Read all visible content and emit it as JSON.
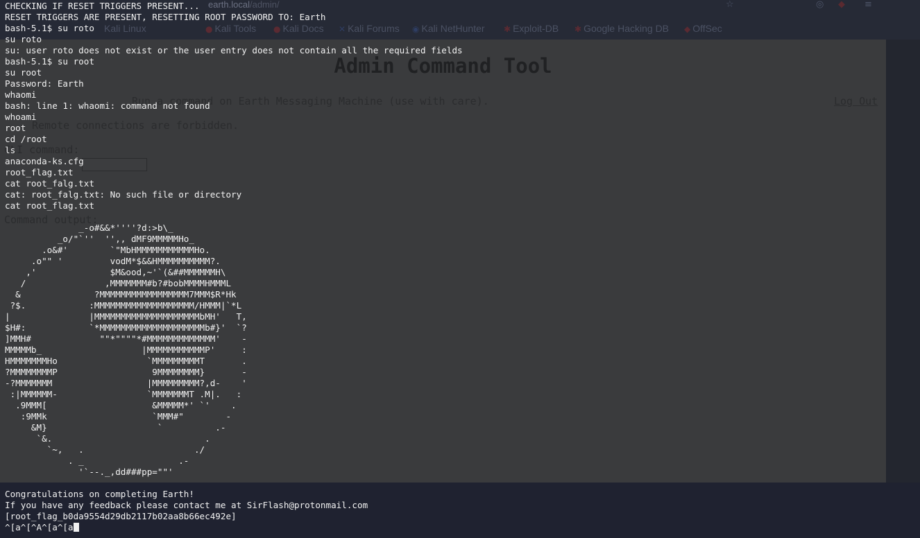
{
  "browser": {
    "url_host": "earth.local",
    "url_path": "/admin/",
    "bookmarks": [
      "Kali Linux",
      "Kali Tools",
      "Kali Docs",
      "Kali Forums",
      "Kali NetHunter",
      "Exploit-DB",
      "Google Hacking DB",
      "OffSec"
    ],
    "page": {
      "title": "Admin Command Tool",
      "intro": "Run a command on Earth Messaging Machine (use with care).",
      "logout": "Log Out",
      "warning": "Remote connections are forbidden.",
      "cli_label": "CLI command:",
      "output_label": "Command output:"
    }
  },
  "terminal": {
    "lines": [
      "CHECKING IF RESET TRIGGERS PRESENT...",
      "RESET TRIGGERS ARE PRESENT, RESETTING ROOT PASSWORD TO: Earth",
      "bash-5.1$ su roto",
      "su roto",
      "su: user roto does not exist or the user entry does not contain all the required fields",
      "bash-5.1$ su root",
      "su root",
      "Password: Earth",
      "whaomi",
      "bash: line 1: whaomi: command not found",
      "whoami",
      "root",
      "cd /root",
      "ls",
      "anaconda-ks.cfg",
      "root_flag.txt",
      "cat root_falg.txt",
      "cat: root_falg.txt: No such file or directory",
      "cat root_flag.txt",
      "",
      "              _-o#&&*''''?d:>b\\_",
      "          _o/\"`''  '',, dMF9MMMMMHo_",
      "       .o&#'        `\"MbHMMMMMMMMMMMHo.",
      "     .o\"\" '         vodM*$&&HMMMMMMMMMM?.",
      "    ,'              $M&ood,~'`(&##MMMMMMH\\",
      "   /               ,MMMMMMM#b?#bobMMMMHMMML",
      "  &              ?MMMMMMMMMMMMMMMMM7MMM$R*Hk",
      " ?$.            :MMMMMMMMMMMMMMMMMMM/HMMM|`*L",
      "|               |MMMMMMMMMMMMMMMMMMMMbMH'   T,",
      "$H#:            `*MMMMMMMMMMMMMMMMMMMMb#}'  `?",
      "]MMH#             \"\"*\"\"\"\"*#MMMMMMMMMMMMM'    -",
      "MMMMMb_                   |MMMMMMMMMMMP'     :",
      "HMMMMMMMHo                 `MMMMMMMMMT       .",
      "?MMMMMMMMP                  9MMMMMMMM}       -",
      "-?MMMMMMM                  |MMMMMMMMM?,d-    '",
      " :|MMMMMM-                 `MMMMMMMT .M|.   :",
      "  .9MMM[                    &MMMMM*' `'    .",
      "   :9MMk                    `MMM#\"        -",
      "     &M}                     `          .-",
      "      `&.                             .",
      "        `~,   .                     ./",
      "            . _                  .-",
      "              '`--._,dd###pp=\"\"'",
      "",
      "Congratulations on completing Earth!",
      "If you have any feedback please contact me at SirFlash@protonmail.com",
      "[root_flag_b0da9554d29db2117b02aa8b66ec492e]"
    ],
    "prompt_input": "^[a^[^A^[a^[a"
  }
}
